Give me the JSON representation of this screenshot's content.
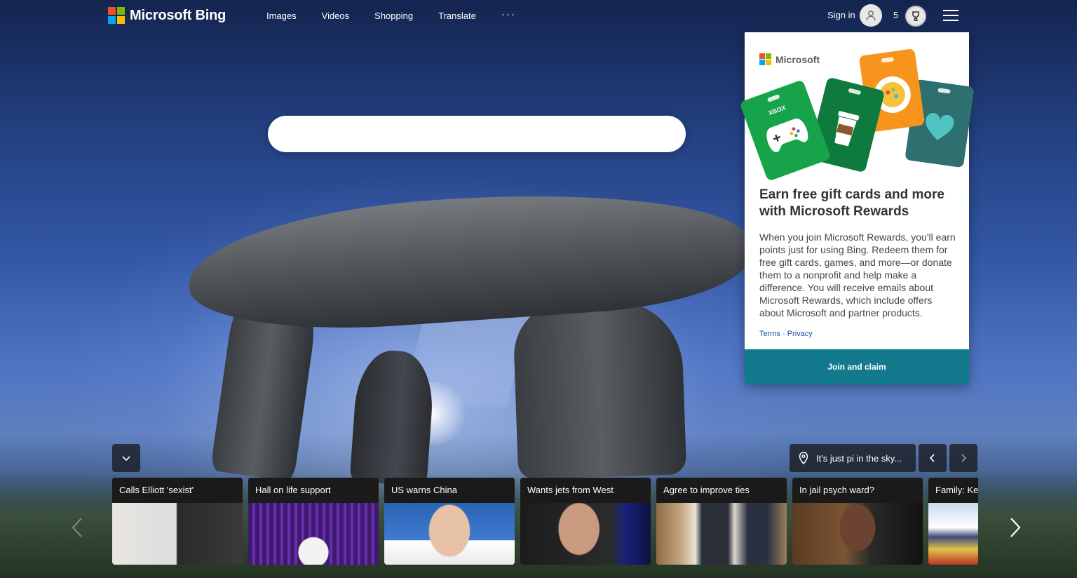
{
  "brand": {
    "name": "Microsoft Bing"
  },
  "nav": {
    "items": [
      "Images",
      "Videos",
      "Shopping",
      "Translate"
    ],
    "more": "···"
  },
  "account": {
    "signin_label": "Sign in",
    "points": "5"
  },
  "search": {
    "value": "",
    "placeholder": ""
  },
  "rewards": {
    "logo_text": "Microsoft",
    "xbox_label": "XBOX",
    "title": "Earn free gift cards and more with Microsoft Rewards",
    "body": "When you join Microsoft Rewards, you'll earn points just for using Bing. Redeem them for free gift cards, games, and more—or donate them to a nonprofit and help make a difference. You will receive emails about Microsoft Rewards, which include offers about Microsoft and partner products.",
    "terms": "Terms",
    "separator": "·",
    "privacy": "Privacy",
    "cta": "Join and claim"
  },
  "image_info": {
    "location_text": "It's just pi in the sky..."
  },
  "news": [
    {
      "title": "Calls Elliott 'sexist'"
    },
    {
      "title": "Hall on life support"
    },
    {
      "title": "US warns China"
    },
    {
      "title": "Wants jets from West"
    },
    {
      "title": "Agree to improve ties"
    },
    {
      "title": "In jail psych ward?"
    },
    {
      "title": "Family: Ke"
    }
  ],
  "colors": {
    "cta_background": "#127a8c",
    "ms_red": "#f25022",
    "ms_green": "#7fba00",
    "ms_blue": "#00a4ef",
    "ms_yellow": "#ffb900"
  }
}
